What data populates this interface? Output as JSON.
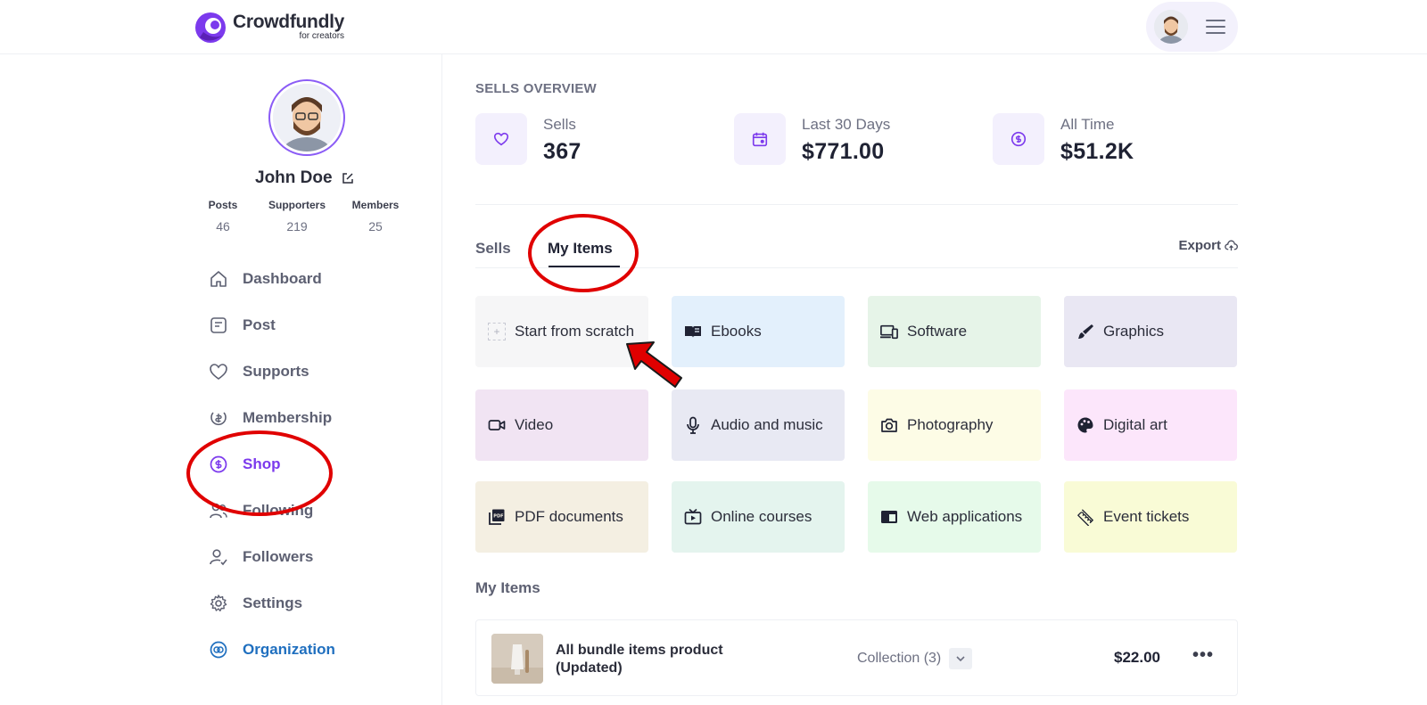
{
  "brand": {
    "name": "Crowdfundly",
    "tagline": "for creators",
    "accent": "#7c3aed"
  },
  "profile": {
    "name": "John Doe",
    "stats": [
      {
        "label": "Posts",
        "value": "46"
      },
      {
        "label": "Supporters",
        "value": "219"
      },
      {
        "label": "Members",
        "value": "25"
      }
    ]
  },
  "nav": [
    {
      "label": "Dashboard",
      "icon": "home-icon",
      "active": false
    },
    {
      "label": "Post",
      "icon": "post-icon",
      "active": false
    },
    {
      "label": "Supports",
      "icon": "heart-icon",
      "active": false
    },
    {
      "label": "Membership",
      "icon": "membership-icon",
      "active": false
    },
    {
      "label": "Shop",
      "icon": "dollar-circle-icon",
      "active": true
    },
    {
      "label": "Following",
      "icon": "users-icon",
      "active": false
    },
    {
      "label": "Followers",
      "icon": "user-check-icon",
      "active": false
    },
    {
      "label": "Settings",
      "icon": "gear-icon",
      "active": false
    },
    {
      "label": "Organization",
      "icon": "organization-icon",
      "active": false
    }
  ],
  "overview": {
    "title": "SELLS OVERVIEW",
    "kpis": [
      {
        "label": "Sells",
        "value": "367",
        "icon": "heart-icon"
      },
      {
        "label": "Last 30 Days",
        "value": "$771.00",
        "icon": "calendar-icon"
      },
      {
        "label": "All Time",
        "value": "$51.2K",
        "icon": "dollar-circle-icon"
      }
    ]
  },
  "tabs": {
    "sells": "Sells",
    "my_items": "My Items",
    "active": "My Items",
    "export": "Export"
  },
  "categories": [
    {
      "label": "Start from scratch",
      "icon": "plus-icon",
      "bg": "#f6f6f7"
    },
    {
      "label": "Ebooks",
      "icon": "book-icon",
      "bg": "#e3f0fc"
    },
    {
      "label": "Software",
      "icon": "devices-icon",
      "bg": "#e6f4e8"
    },
    {
      "label": "Graphics",
      "icon": "brush-icon",
      "bg": "#e9e7f3"
    },
    {
      "label": "Video",
      "icon": "video-icon",
      "bg": "#f1e4f3"
    },
    {
      "label": "Audio and music",
      "icon": "microphone-icon",
      "bg": "#e8e9f3"
    },
    {
      "label": "Photography",
      "icon": "camera-icon",
      "bg": "#fdfce6"
    },
    {
      "label": "Digital art",
      "icon": "palette-icon",
      "bg": "#fce6fb"
    },
    {
      "label": "PDF documents",
      "icon": "pdf-icon",
      "bg": "#f4efe2"
    },
    {
      "label": "Online courses",
      "icon": "tv-icon",
      "bg": "#e4f4ee"
    },
    {
      "label": "Web applications",
      "icon": "web-app-icon",
      "bg": "#e6faea"
    },
    {
      "label": "Event tickets",
      "icon": "ticket-icon",
      "bg": "#f9fbd6"
    }
  ],
  "items": {
    "title": "My Items",
    "rows": [
      {
        "name": "All bundle items product (Updated)",
        "collection": "Collection (3)",
        "price": "$22.00"
      }
    ]
  }
}
